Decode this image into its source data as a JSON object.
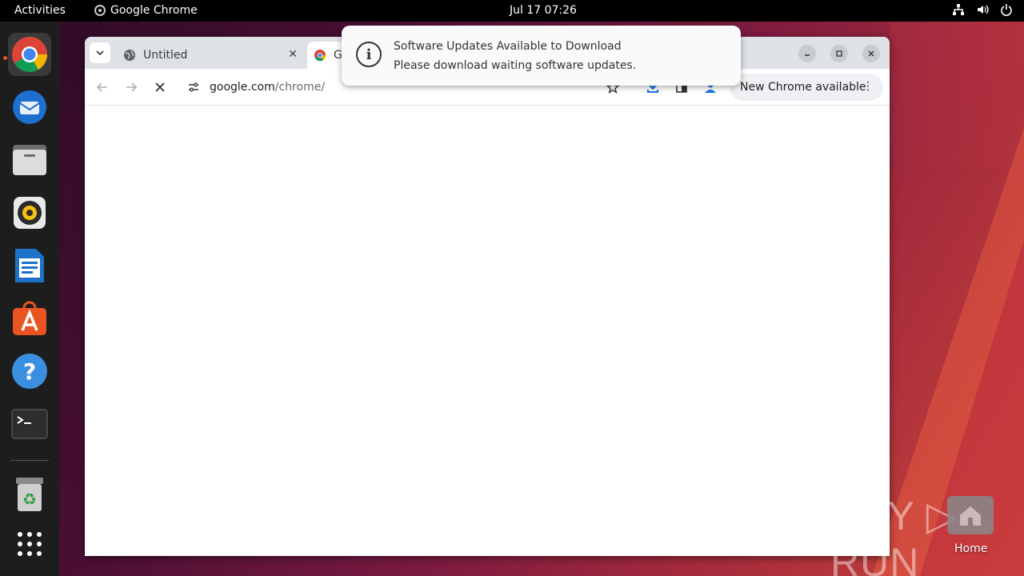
{
  "topbar": {
    "activities": "Activities",
    "app_menu": "Google Chrome",
    "clock": "Jul 17  07:26"
  },
  "dock": {
    "items": [
      "chrome-icon",
      "thunderbird-icon",
      "files-icon",
      "rhythmbox-icon",
      "writer-icon",
      "app-center-icon",
      "help-icon",
      "terminal-icon",
      "trash-icon",
      "show-apps-icon"
    ]
  },
  "browser": {
    "tabs": [
      {
        "title": "Untitled"
      },
      {
        "title": "G"
      }
    ],
    "url_host": "google.com",
    "url_path": "/chrome/",
    "new_chrome_label": "New Chrome available"
  },
  "notification": {
    "title": "Software Updates Available to Download",
    "body": "Please download waiting software updates."
  },
  "desktop": {
    "watermark": "ANY ▷ RUN",
    "home_label": "Home"
  },
  "colors": {
    "accent": "#e95420",
    "dock_bg": "#1d1d1d",
    "tabstrip_bg": "#dee1e6"
  }
}
